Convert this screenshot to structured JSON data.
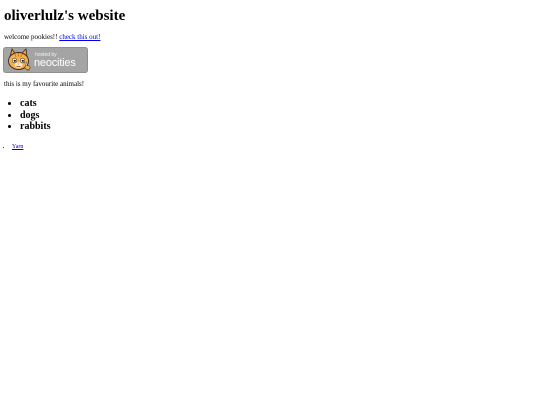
{
  "page": {
    "title": "oliverlulz's website",
    "welcome_text": "welcome pookies!! ",
    "welcome_link": "check this out!"
  },
  "badge": {
    "small_text": "hosted by",
    "big_text": "neocities",
    "icon": "neocities-cat-icon",
    "background_color": "#a4a4a4"
  },
  "animals": {
    "intro": "this is my favourite animals!",
    "items": [
      "cats",
      "dogs",
      "rabbits"
    ]
  },
  "links": {
    "items": [
      "Yarn"
    ]
  },
  "colors": {
    "link": "#0000ee",
    "text": "#000000",
    "background": "#ffffff"
  }
}
